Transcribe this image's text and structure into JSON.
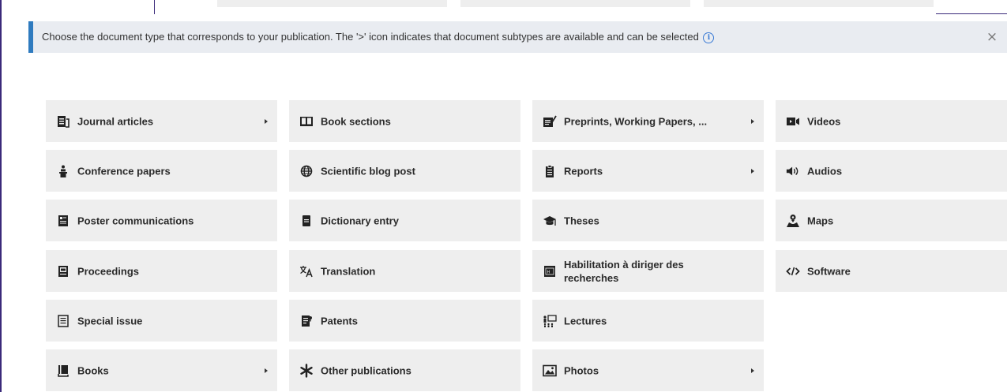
{
  "info": {
    "message": "Choose the document type that corresponds to your publication. The '>' icon indicates that document subtypes are available and can be selected",
    "info_icon": "i",
    "close_symbol": "×"
  },
  "doc_types": {
    "journal_articles": "Journal articles",
    "conference_papers": "Conference papers",
    "poster_communications": "Poster communications",
    "proceedings": "Proceedings",
    "special_issue": "Special issue",
    "books": "Books",
    "book_sections": "Book sections",
    "scientific_blog_post": "Scientific blog post",
    "dictionary_entry": "Dictionary entry",
    "translation": "Translation",
    "patents": "Patents",
    "other_publications": "Other publications",
    "preprints": "Preprints, Working Papers, ...",
    "reports": "Reports",
    "theses": "Theses",
    "habilitation": "Habilitation à diriger des recherches",
    "lectures": "Lectures",
    "photos": "Photos",
    "videos": "Videos",
    "audios": "Audios",
    "maps": "Maps",
    "software": "Software"
  },
  "icons": {
    "journal_articles": "journal-icon",
    "conference_papers": "podium-icon",
    "poster_communications": "poster-icon",
    "proceedings": "proceedings-icon",
    "special_issue": "special-issue-icon",
    "books": "book-icon",
    "book_sections": "open-book-icon",
    "scientific_blog_post": "globe-icon",
    "dictionary_entry": "dictionary-icon",
    "translation": "translate-icon",
    "patents": "patent-icon",
    "other_publications": "asterisk-icon",
    "preprints": "preprint-icon",
    "reports": "clipboard-icon",
    "theses": "graduation-cap-icon",
    "habilitation": "habilitation-icon",
    "lectures": "lecture-icon",
    "photos": "image-icon",
    "videos": "video-camera-icon",
    "audios": "speaker-icon",
    "maps": "map-icon",
    "software": "code-icon"
  },
  "has_subtypes": [
    "journal_articles",
    "books",
    "preprints",
    "reports",
    "photos"
  ],
  "colors": {
    "accent": "#2f7bbf",
    "tile_bg": "#eeeeee",
    "info_bg": "#e9ecf1",
    "frame": "#3b2a7a"
  }
}
